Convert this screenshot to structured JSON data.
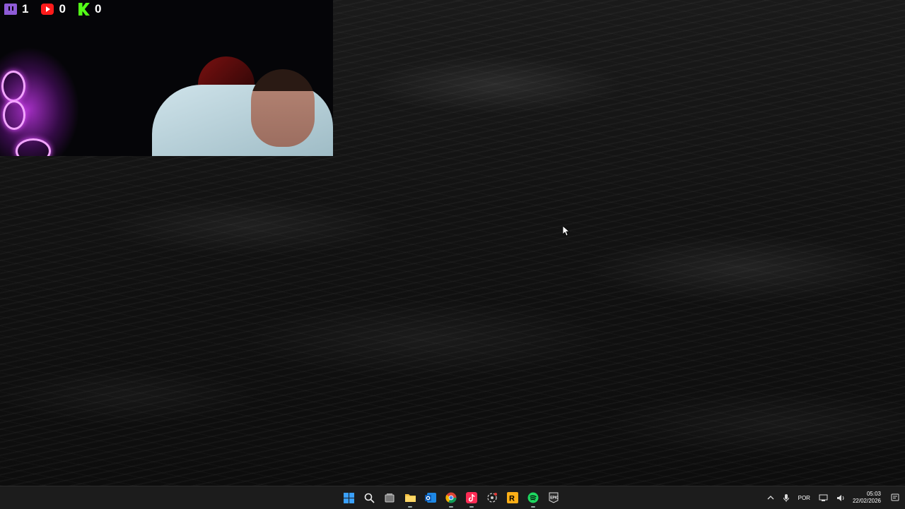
{
  "overlay": {
    "counters": [
      {
        "platform": "twitch",
        "icon": "twitch-icon",
        "value": "1"
      },
      {
        "platform": "youtube",
        "icon": "youtube-icon",
        "value": "0"
      },
      {
        "platform": "kick",
        "icon": "kick-icon",
        "value": "0"
      }
    ]
  },
  "taskbar": {
    "apps": [
      {
        "name": "start",
        "icon": "windows-start-icon"
      },
      {
        "name": "search",
        "icon": "search-icon"
      },
      {
        "name": "task-view",
        "icon": "task-view-icon"
      },
      {
        "name": "file-explorer",
        "icon": "folder-icon"
      },
      {
        "name": "outlook",
        "icon": "outlook-icon"
      },
      {
        "name": "chrome",
        "icon": "chrome-icon"
      },
      {
        "name": "tiktok",
        "icon": "tiktok-icon"
      },
      {
        "name": "obs-network",
        "icon": "network-app-icon"
      },
      {
        "name": "rockstar",
        "icon": "rockstar-icon"
      },
      {
        "name": "spotify",
        "icon": "spotify-icon"
      },
      {
        "name": "epic-games",
        "icon": "epic-games-icon"
      }
    ],
    "tray": {
      "language": "POR",
      "time": "05:03",
      "date": "22/02/2026"
    }
  }
}
